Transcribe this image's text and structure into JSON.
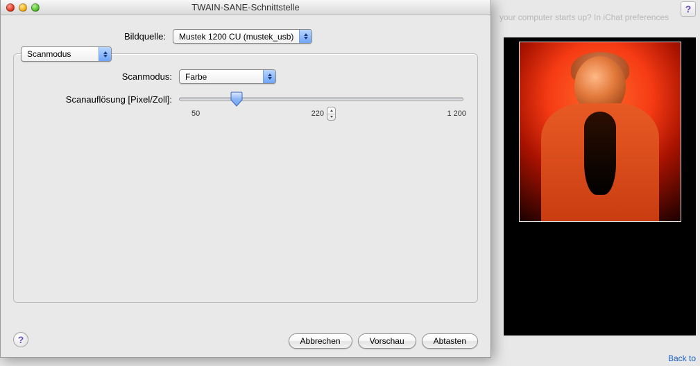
{
  "bg": {
    "help_glyph": "?",
    "faded_text": "your computer starts up? In iChat preferences",
    "back_link": "Back to"
  },
  "window": {
    "title": "TWAIN-SANE-Schnittstelle"
  },
  "source": {
    "label": "Bildquelle:",
    "value": "Mustek 1200 CU (mustek_usb)"
  },
  "tab": {
    "value": "Scanmodus"
  },
  "mode": {
    "label": "Scanmodus:",
    "value": "Farbe"
  },
  "resolution": {
    "label": "Scanauflösung [Pixel/Zoll]:",
    "min": "50",
    "value": "220",
    "max": "1 200"
  },
  "buttons": {
    "cancel": "Abbrechen",
    "preview": "Vorschau",
    "scan": "Abtasten",
    "help_glyph": "?"
  }
}
